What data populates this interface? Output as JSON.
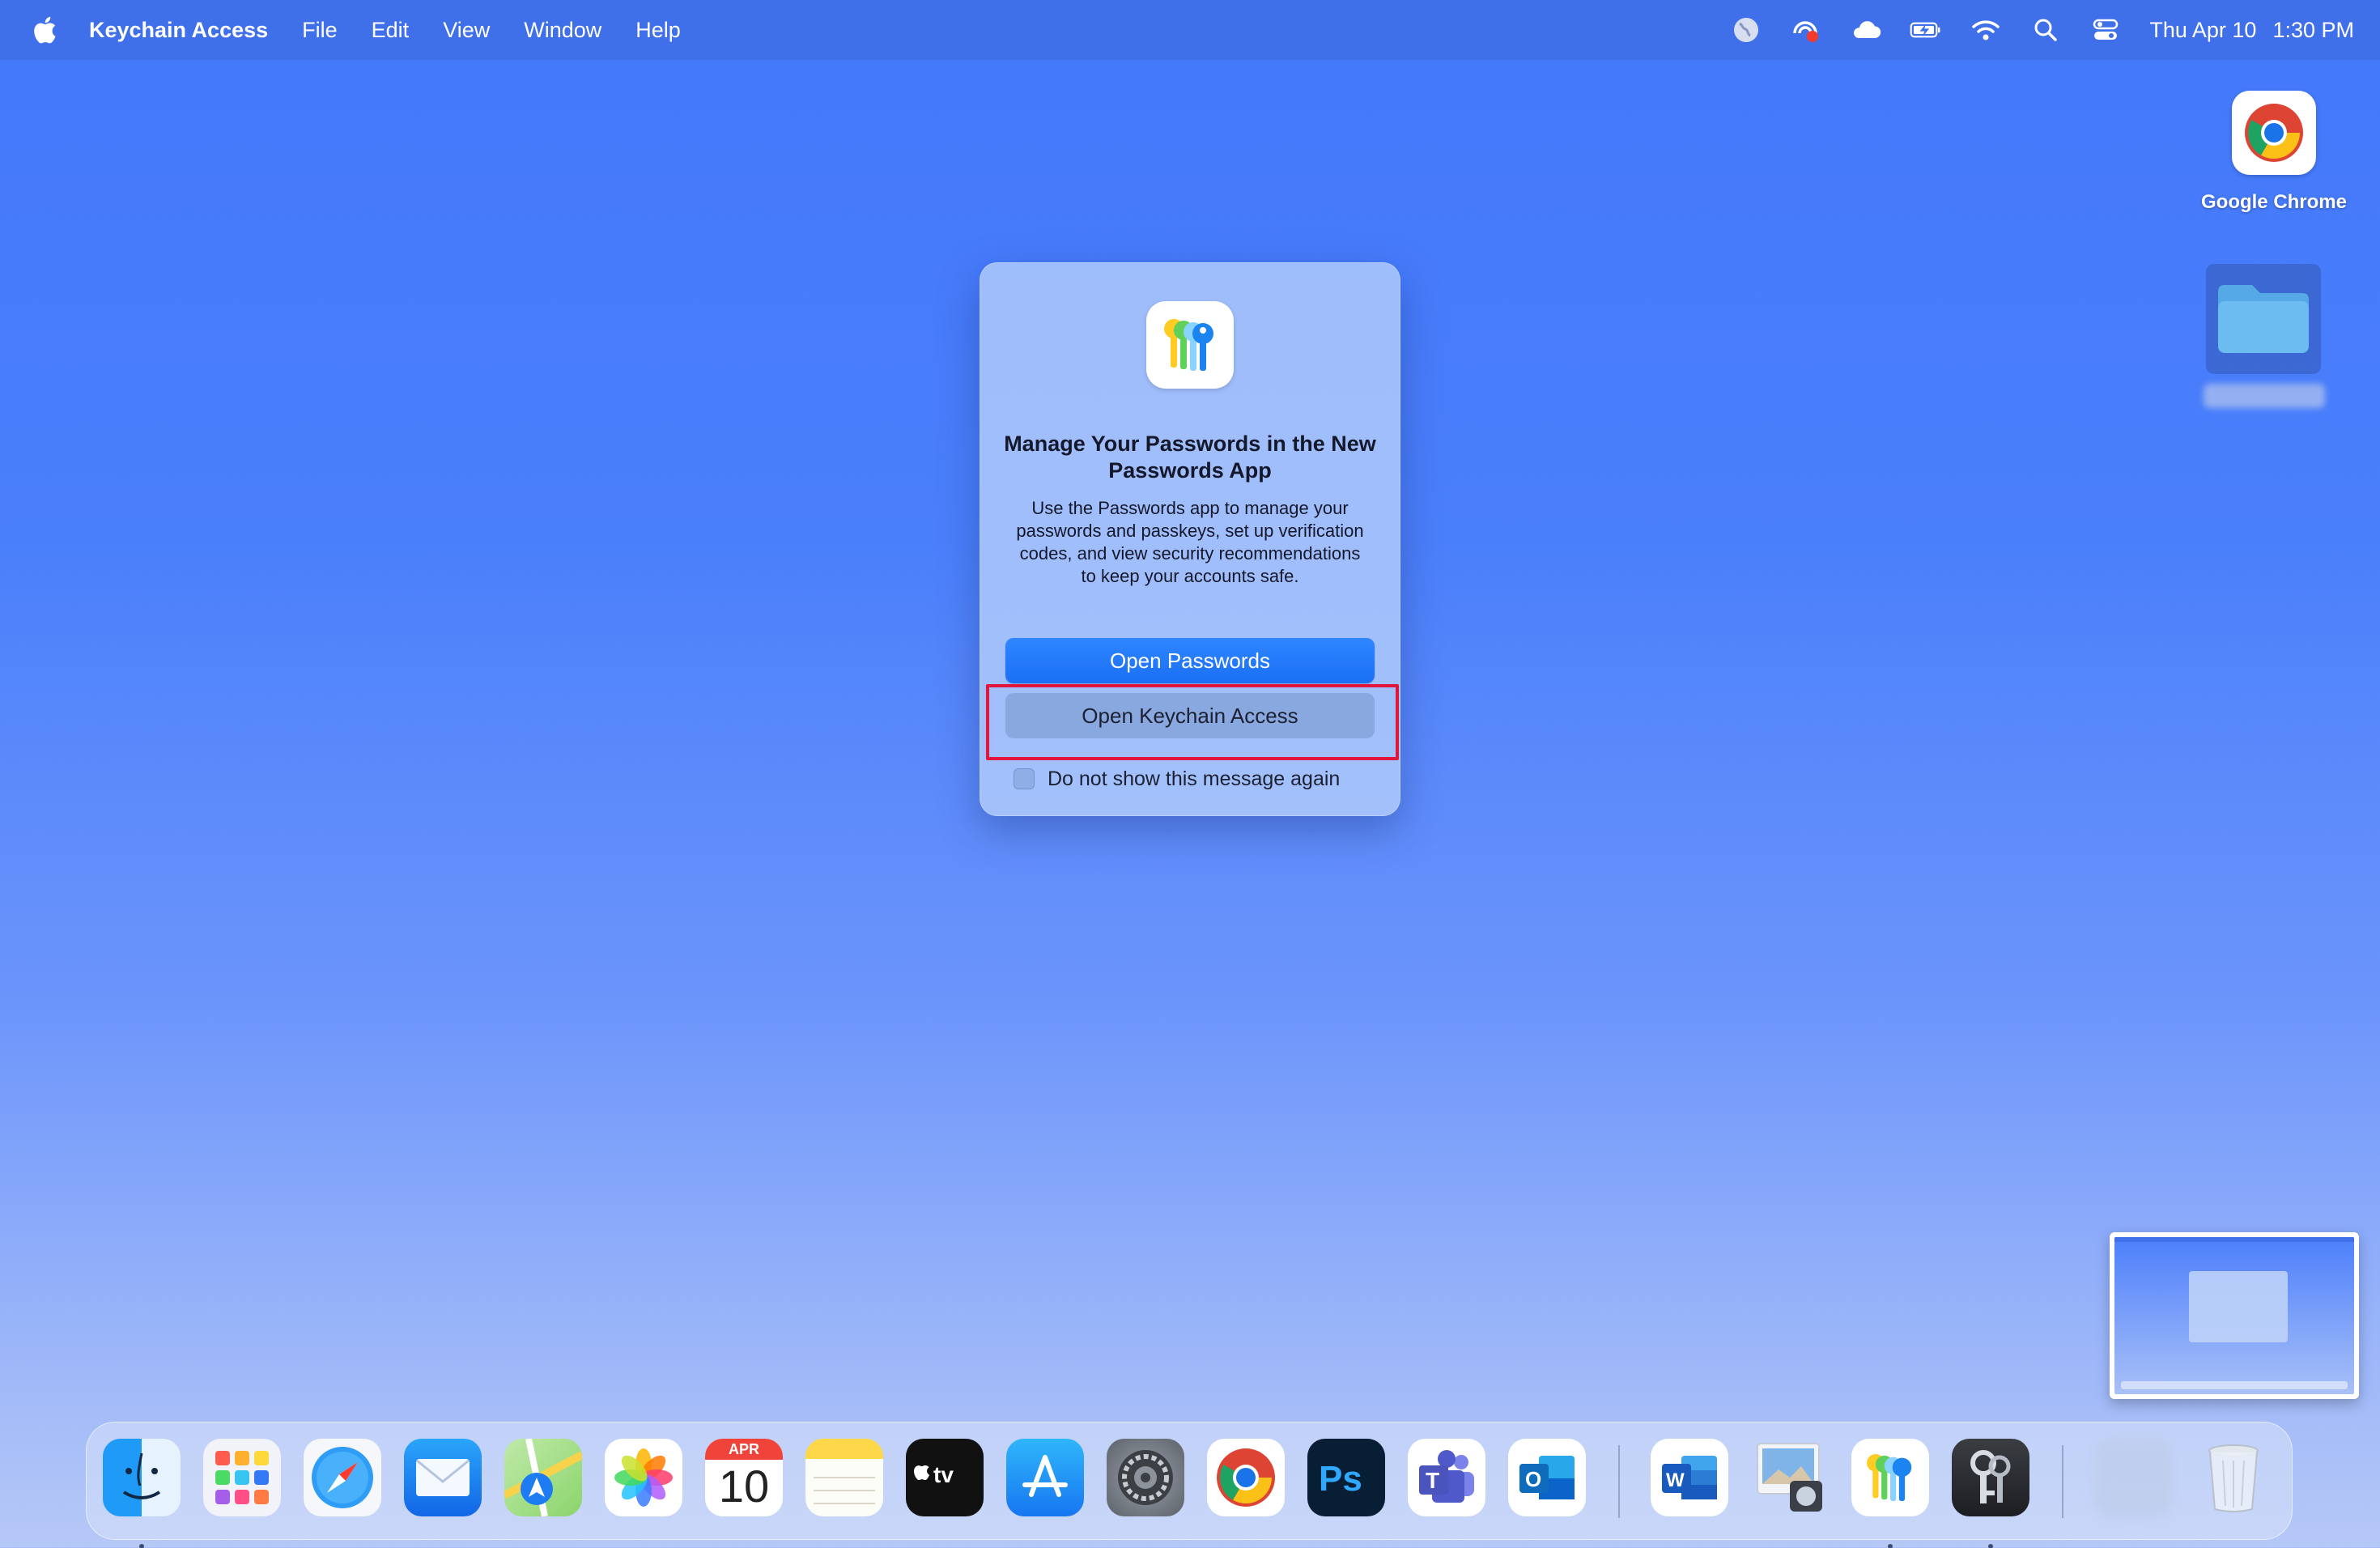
{
  "menubar": {
    "apple_icon": "apple-logo-icon",
    "app_name": "Keychain Access",
    "menus": [
      "File",
      "Edit",
      "View",
      "Window",
      "Help"
    ],
    "status_icons": [
      "globe-icon",
      "screen-record-icon",
      "icloud-icon",
      "battery-charging-icon",
      "wifi-icon",
      "search-icon",
      "control-center-icon"
    ],
    "date": "Thu Apr 10",
    "time": "1:30 PM"
  },
  "desktop": {
    "items": [
      {
        "label": "Google Chrome",
        "icon": "chrome-icon"
      },
      {
        "label": "",
        "icon": "folder-icon"
      }
    ]
  },
  "dialog": {
    "icon": "passwords-app-icon",
    "title": "Manage Your Passwords in the New Passwords App",
    "body": "Use the Passwords app to manage your passwords and passkeys, set up verification codes, and view security recommendations to keep your accounts safe.",
    "primary_button": "Open Passwords",
    "secondary_button": "Open Keychain Access",
    "checkbox_label": "Do not show this message again",
    "checkbox_checked": false,
    "highlight_color": "#e2153b"
  },
  "dock": {
    "calendar_month": "APR",
    "calendar_day": "10",
    "apps": [
      {
        "name": "Finder",
        "icon": "finder-icon",
        "running": true
      },
      {
        "name": "Launchpad",
        "icon": "launchpad-icon",
        "running": false
      },
      {
        "name": "Safari",
        "icon": "safari-icon",
        "running": false
      },
      {
        "name": "Mail",
        "icon": "mail-icon",
        "running": false
      },
      {
        "name": "Maps",
        "icon": "maps-icon",
        "running": false
      },
      {
        "name": "Photos",
        "icon": "photos-icon",
        "running": false
      },
      {
        "name": "Calendar",
        "icon": "calendar-icon",
        "running": false
      },
      {
        "name": "Notes",
        "icon": "notes-icon",
        "running": false
      },
      {
        "name": "TV",
        "icon": "apple-tv-icon",
        "running": false
      },
      {
        "name": "App Store",
        "icon": "app-store-icon",
        "running": false
      },
      {
        "name": "System Settings",
        "icon": "system-settings-icon",
        "running": false
      },
      {
        "name": "Chrome",
        "icon": "chrome-icon",
        "running": false
      },
      {
        "name": "Photoshop",
        "icon": "photoshop-icon",
        "running": false
      },
      {
        "name": "Teams",
        "icon": "teams-icon",
        "running": false
      },
      {
        "name": "Outlook",
        "icon": "outlook-icon",
        "running": false
      },
      {
        "name": "Word",
        "icon": "word-icon",
        "running": false
      },
      {
        "name": "Preview",
        "icon": "preview-icon",
        "running": false
      },
      {
        "name": "Passwords",
        "icon": "passwords-icon",
        "running": true
      },
      {
        "name": "Keychain Access",
        "icon": "keychain-access-icon",
        "running": true
      },
      {
        "name": "Downloads",
        "icon": "downloads-stack-icon",
        "running": false
      },
      {
        "name": "Trash",
        "icon": "trash-icon",
        "running": false
      }
    ]
  }
}
